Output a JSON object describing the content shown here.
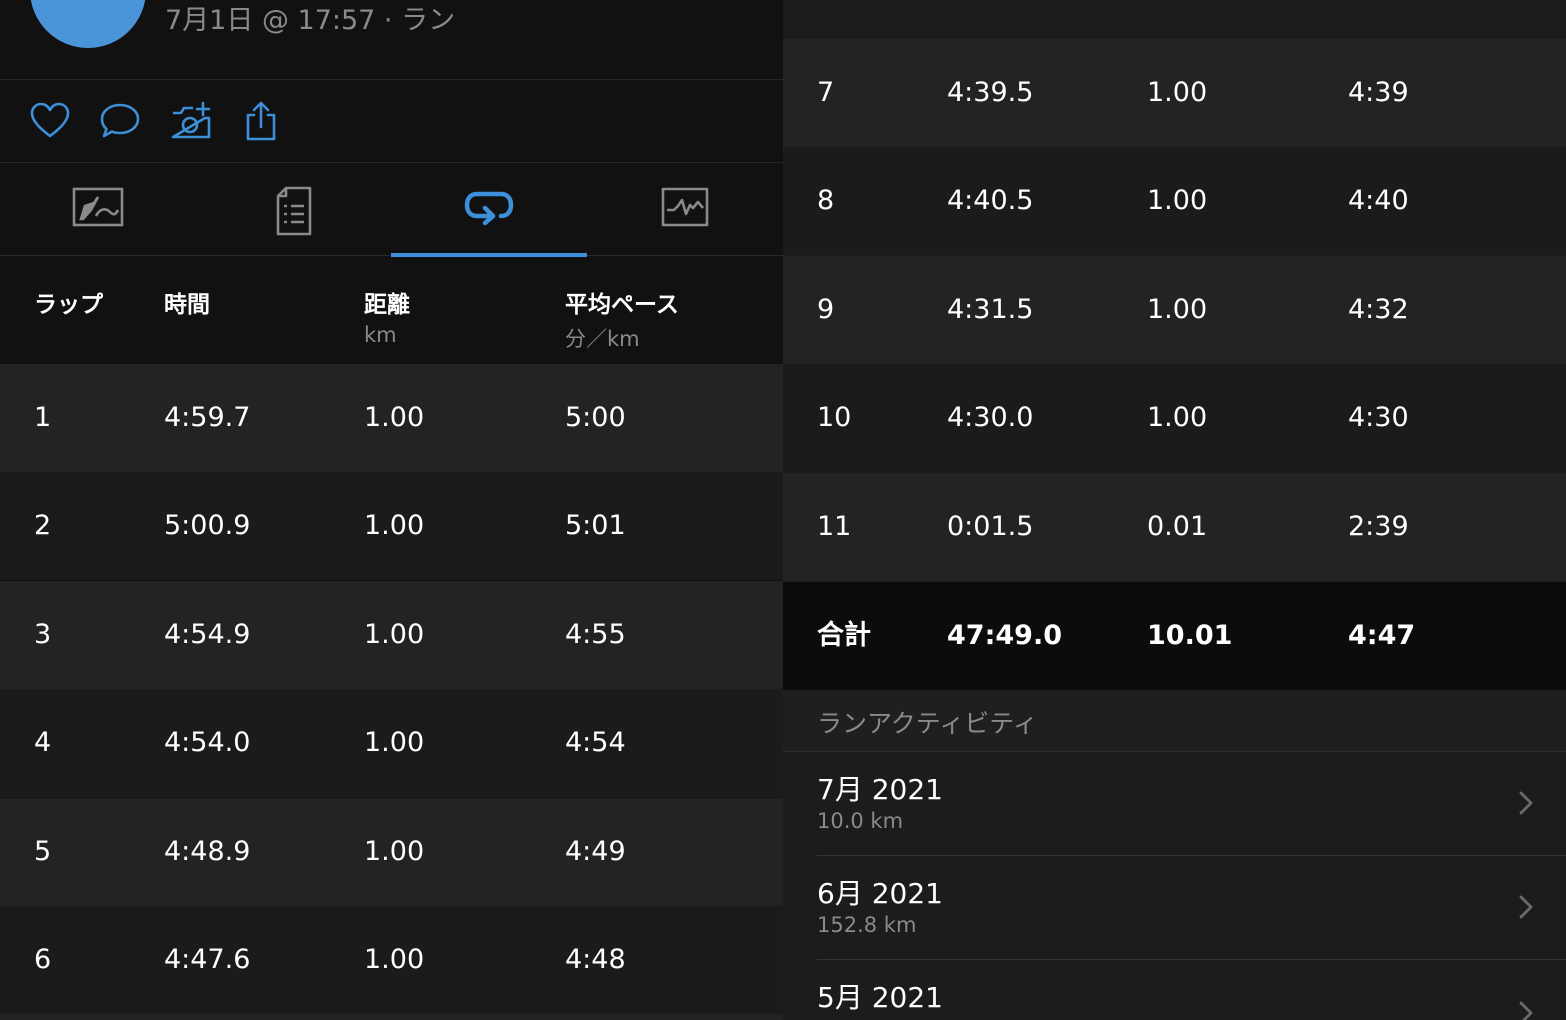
{
  "header": {
    "meta": "7月1日 @ 17:57 · ラン"
  },
  "actions": [
    {
      "name": "like",
      "icon": "heart-icon"
    },
    {
      "name": "comment",
      "icon": "comment-icon"
    },
    {
      "name": "add-photo",
      "icon": "camera-plus-icon"
    },
    {
      "name": "share",
      "icon": "share-icon"
    }
  ],
  "tabs": [
    {
      "name": "map",
      "icon": "map-icon",
      "active": false
    },
    {
      "name": "stats",
      "icon": "document-icon",
      "active": false
    },
    {
      "name": "laps",
      "icon": "laps-icon",
      "active": true
    },
    {
      "name": "charts",
      "icon": "chart-icon",
      "active": false
    }
  ],
  "laps_table": {
    "columns": [
      {
        "title": "ラップ",
        "unit": ""
      },
      {
        "title": "時間",
        "unit": ""
      },
      {
        "title": "距離",
        "unit": "km"
      },
      {
        "title": "平均ペース",
        "unit": "分／km"
      }
    ],
    "rows": [
      [
        "1",
        "4:59.7",
        "1.00",
        "5:00"
      ],
      [
        "2",
        "5:00.9",
        "1.00",
        "5:01"
      ],
      [
        "3",
        "4:54.9",
        "1.00",
        "4:55"
      ],
      [
        "4",
        "4:54.0",
        "1.00",
        "4:54"
      ],
      [
        "5",
        "4:48.9",
        "1.00",
        "4:49"
      ],
      [
        "6",
        "4:47.6",
        "1.00",
        "4:48"
      ],
      [
        "7",
        "4:39.5",
        "1.00",
        "4:39"
      ],
      [
        "8",
        "4:40.5",
        "1.00",
        "4:40"
      ],
      [
        "9",
        "4:31.5",
        "1.00",
        "4:32"
      ],
      [
        "10",
        "4:30.0",
        "1.00",
        "4:30"
      ],
      [
        "11",
        "0:01.5",
        "0.01",
        "2:39"
      ]
    ],
    "total": [
      "合計",
      "47:49.0",
      "10.01",
      "4:47"
    ]
  },
  "activity_section": {
    "title": "ランアクティビティ",
    "months": [
      {
        "label": "7月 2021",
        "distance": "10.0 km"
      },
      {
        "label": "6月 2021",
        "distance": "152.8 km"
      },
      {
        "label": "5月 2021",
        "distance": ""
      }
    ]
  },
  "colors": {
    "accent": "#3d8fd9",
    "background": "#111111",
    "row_light": "#232323",
    "row_dark": "#1b1b1b",
    "secondary_text": "#8a8a8a"
  }
}
